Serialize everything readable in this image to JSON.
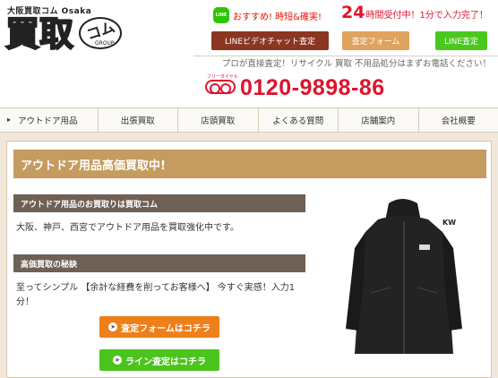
{
  "header": {
    "logo_sub": "大阪買取コム Osaka",
    "logo_main": "買取",
    "logo_komu": "コム",
    "logo_group": "GROUP",
    "line_badge": "LINE",
    "line_text": "おすすめ! 時短&確実!",
    "hours_num": "24",
    "hours_text": "時間受付中！1分で入力完了！",
    "btn_video": "LINEビデオチャット査定",
    "btn_form": "査定フォーム",
    "btn_line": "LINE査定",
    "tagline": "プロが直接査定！リサイクル 買取 不用品処分はまずお電話ください！",
    "freedial": "フリーダイヤル",
    "phone": "0120-9898-86"
  },
  "nav": {
    "items": [
      {
        "label": "アウトドア用品"
      },
      {
        "label": "出張買取"
      },
      {
        "label": "店頭買取"
      },
      {
        "label": "よくある質問"
      },
      {
        "label": "店舗案内"
      },
      {
        "label": "会社概要"
      }
    ]
  },
  "main": {
    "title": "アウトドア用品高価買取中!",
    "sub1": "アウトドア用品のお買取りは買取コム",
    "para1": "大阪、神戸、西宮でアウトドア用品を買取強化中です。",
    "sub2": "高価買取の秘訣",
    "para2": "至ってシンプル 【余計な経費を削ってお客様へ】 今すぐ実感！入力1分！",
    "btn_form": "査定フォームはコチラ",
    "btn_line": "ライン査定はコチラ",
    "image_label": "KW"
  },
  "colors": {
    "brand_red": "#e0122d",
    "title_tan": "#c59b5f",
    "sub_brown": "#6f6055",
    "orange": "#ef7f1a",
    "green": "#4cc41e"
  }
}
